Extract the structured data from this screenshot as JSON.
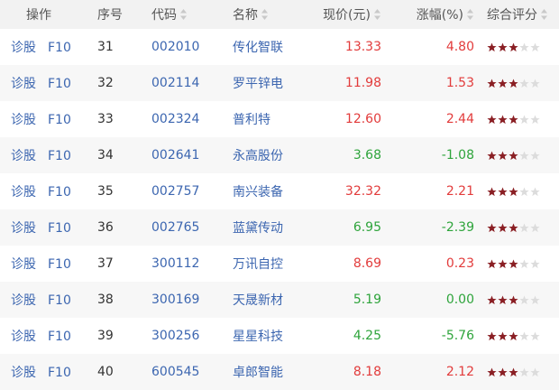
{
  "header": {
    "ops": "操作",
    "seq": "序号",
    "code": "代码",
    "name": "名称",
    "price": "现价(元)",
    "change": "涨幅(%)",
    "rating": "综合评分"
  },
  "ops_labels": {
    "diagnose": "诊股",
    "f10": "F10"
  },
  "colors": {
    "up": "#e23b3b",
    "down": "#2ea43b",
    "link": "#3c66b0",
    "star_on": "#8a1f24",
    "star_off": "#dcdcdc"
  },
  "rows": [
    {
      "seq": "31",
      "code": "002010",
      "name": "传化智联",
      "price": "13.33",
      "change": "4.80",
      "dir": "up",
      "stars": 3
    },
    {
      "seq": "32",
      "code": "002114",
      "name": "罗平锌电",
      "price": "11.98",
      "change": "1.53",
      "dir": "up",
      "stars": 3
    },
    {
      "seq": "33",
      "code": "002324",
      "name": "普利特",
      "price": "12.60",
      "change": "2.44",
      "dir": "up",
      "stars": 3
    },
    {
      "seq": "34",
      "code": "002641",
      "name": "永高股份",
      "price": "3.68",
      "change": "-1.08",
      "dir": "down",
      "stars": 3
    },
    {
      "seq": "35",
      "code": "002757",
      "name": "南兴装备",
      "price": "32.32",
      "change": "2.21",
      "dir": "up",
      "stars": 3
    },
    {
      "seq": "36",
      "code": "002765",
      "name": "蓝黛传动",
      "price": "6.95",
      "change": "-2.39",
      "dir": "down",
      "stars": 3
    },
    {
      "seq": "37",
      "code": "300112",
      "name": "万讯自控",
      "price": "8.69",
      "change": "0.23",
      "dir": "up",
      "stars": 3
    },
    {
      "seq": "38",
      "code": "300169",
      "name": "天晟新材",
      "price": "5.19",
      "change": "0.00",
      "dir": "flat",
      "stars": 3
    },
    {
      "seq": "39",
      "code": "300256",
      "name": "星星科技",
      "price": "4.25",
      "change": "-5.76",
      "dir": "down",
      "stars": 3
    },
    {
      "seq": "40",
      "code": "600545",
      "name": "卓郎智能",
      "price": "8.18",
      "change": "2.12",
      "dir": "up",
      "stars": 3
    }
  ]
}
